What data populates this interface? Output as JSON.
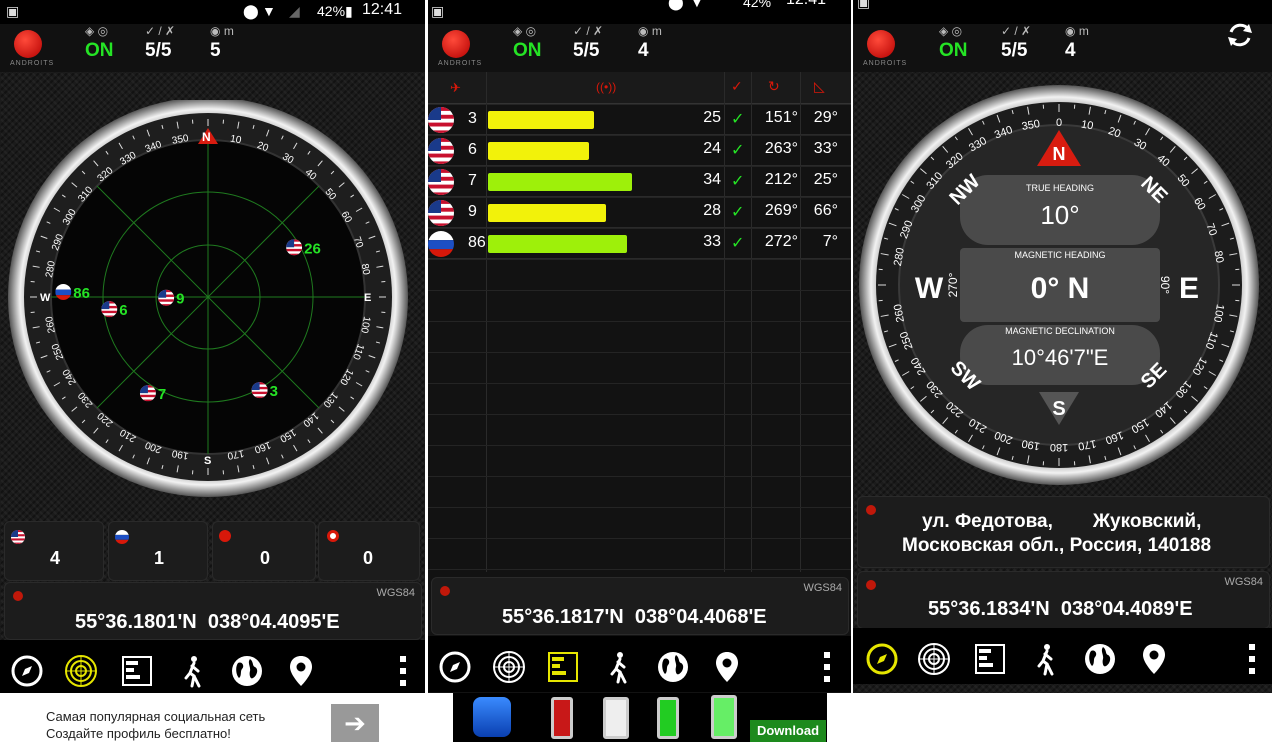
{
  "panels": [
    {
      "status": {
        "battery": "42%",
        "time": "12:41"
      },
      "header": {
        "gps_state": "ON",
        "sats": "5/5",
        "accuracy": "5",
        "accuracy_unit": "m"
      },
      "radar": {
        "n_label": "N",
        "e_label": "E",
        "s_label": "S",
        "w_label": "W",
        "sats": [
          {
            "id": "26",
            "flag": "us"
          },
          {
            "id": "86",
            "flag": "ru"
          },
          {
            "id": "6",
            "flag": "us"
          },
          {
            "id": "9",
            "flag": "us"
          },
          {
            "id": "7",
            "flag": "us"
          },
          {
            "id": "3",
            "flag": "us"
          }
        ],
        "ticks": [
          "10",
          "20",
          "30",
          "40",
          "50",
          "60",
          "70",
          "80",
          "100",
          "110",
          "120",
          "130",
          "140",
          "150",
          "160",
          "170",
          "190",
          "200",
          "210",
          "220",
          "230",
          "240",
          "250",
          "260",
          "280",
          "290",
          "300",
          "310",
          "320",
          "330",
          "340",
          "350"
        ]
      },
      "counts": {
        "gps": "4",
        "glonass": "1",
        "beidou": "0",
        "galileo": "0"
      },
      "coordinates": {
        "datum": "WGS84",
        "lat": "55°36.1801'N",
        "lon": "038°04.4095'E"
      }
    },
    {
      "status": {
        "battery": "42%",
        "time": "12:41"
      },
      "header": {
        "gps_state": "ON",
        "sats": "5/5",
        "accuracy": "4",
        "accuracy_unit": "m"
      },
      "satellites": [
        {
          "flag": "us",
          "id": "3",
          "snr": "25",
          "fix": "✓",
          "azimuth": "151°",
          "elevation": "29°",
          "snr_value": 25,
          "bar_color": "#f2f20a"
        },
        {
          "flag": "us",
          "id": "6",
          "snr": "24",
          "fix": "✓",
          "azimuth": "263°",
          "elevation": "33°",
          "snr_value": 24,
          "bar_color": "#f2f20a"
        },
        {
          "flag": "us",
          "id": "7",
          "snr": "34",
          "fix": "✓",
          "azimuth": "212°",
          "elevation": "25°",
          "snr_value": 34,
          "bar_color": "#9ef00a"
        },
        {
          "flag": "us",
          "id": "9",
          "snr": "28",
          "fix": "✓",
          "azimuth": "269°",
          "elevation": "66°",
          "snr_value": 28,
          "bar_color": "#f2f20a"
        },
        {
          "flag": "ru",
          "id": "86",
          "snr": "33",
          "fix": "✓",
          "azimuth": "272°",
          "elevation": "7°",
          "snr_value": 33,
          "bar_color": "#9ef00a"
        }
      ],
      "coordinates": {
        "datum": "WGS84",
        "lat": "55°36.1817'N",
        "lon": "038°04.4068'E"
      }
    },
    {
      "status": {
        "battery": "",
        "time": ""
      },
      "header": {
        "gps_state": "ON",
        "sats": "5/5",
        "accuracy": "4",
        "accuracy_unit": "m"
      },
      "compass": {
        "true_heading_label": "TRUE HEADING",
        "true_heading": "10°",
        "magnetic_heading_label": "MAGNETIC HEADING",
        "magnetic_heading": "0° N",
        "declination_label": "MAGNETIC DECLINATION",
        "declination": "10°46'7\"E",
        "n": "N",
        "ne": "NE",
        "e": "E",
        "se": "SE",
        "s": "S",
        "sw": "SW",
        "w": "W",
        "nw": "NW",
        "deg_270": "270°",
        "deg_90": "90°"
      },
      "address": {
        "line1_a": "ул. Федотова,",
        "line1_b": "Жуковский,",
        "line2": "Московская обл., Россия, 140188"
      },
      "coordinates": {
        "datum": "WGS84",
        "lat": "55°36.1834'N",
        "lon": "038°04.4089'E"
      }
    }
  ],
  "logo_text": "ANDROITS",
  "ad": {
    "text_line1": "Самая популярная социальная сеть",
    "text_line2": "Создайте профиль бесплатно!",
    "download": "Download"
  },
  "colors": {
    "accent_green": "#25e325",
    "active_icon": "#e6e600",
    "pin_red": "#c0180a"
  }
}
